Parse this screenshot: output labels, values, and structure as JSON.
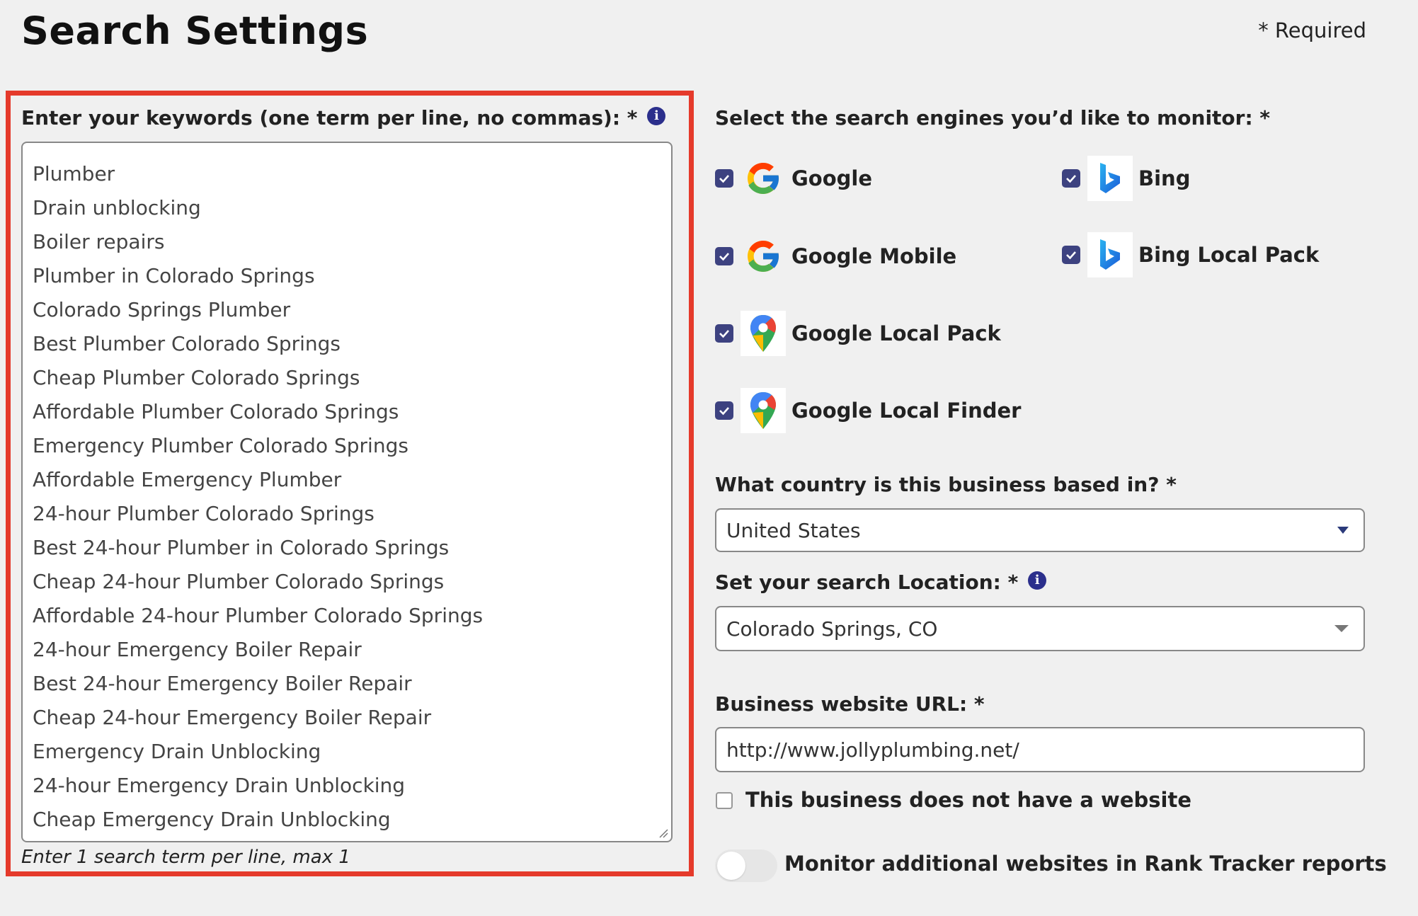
{
  "header": {
    "title": "Search Settings",
    "required_note": "*  Required"
  },
  "keywords": {
    "label": "Enter your keywords (one term per line, no commas): *",
    "info_icon": "info-icon",
    "lines": [
      "Plumber",
      "Drain unblocking",
      "Boiler repairs",
      "Plumber in Colorado Springs",
      "Colorado Springs Plumber",
      "Best Plumber Colorado Springs",
      "Cheap Plumber Colorado Springs",
      "Affordable Plumber Colorado Springs",
      "Emergency Plumber Colorado Springs",
      "Affordable Emergency Plumber",
      "24-hour Plumber Colorado Springs",
      "Best 24-hour Plumber in Colorado Springs",
      "Cheap 24-hour Plumber Colorado Springs",
      "Affordable 24-hour Plumber Colorado Springs",
      "24-hour Emergency Boiler Repair",
      "Best 24-hour Emergency Boiler Repair",
      "Cheap 24-hour Emergency Boiler Repair",
      "Emergency Drain Unblocking",
      "24-hour Emergency Drain Unblocking",
      "Cheap Emergency Drain Unblocking"
    ],
    "helper": "Enter 1 search term per line, max 1",
    "highlight_color": "#e53a2b"
  },
  "engines": {
    "label": "Select the search engines you’d like to monitor: *",
    "items": [
      {
        "name": "Google",
        "checked": true,
        "icon": "google-icon"
      },
      {
        "name": "Bing",
        "checked": true,
        "icon": "bing-icon"
      },
      {
        "name": "Google Mobile",
        "checked": true,
        "icon": "google-icon"
      },
      {
        "name": "Bing Local Pack",
        "checked": true,
        "icon": "bing-icon"
      },
      {
        "name": "Google Local Pack",
        "checked": true,
        "icon": "google-maps-pin-icon"
      },
      {
        "name": "Google Local Finder",
        "checked": true,
        "icon": "google-maps-pin-icon"
      }
    ]
  },
  "country": {
    "label": "What country is this business based in? *",
    "value": "United States"
  },
  "location": {
    "label": "Set your search Location: *",
    "value": "Colorado Springs, CO"
  },
  "website": {
    "label": "Business website URL: *",
    "value": "http://www.jollyplumbing.net/"
  },
  "no_website": {
    "label": "This business does not have a website",
    "checked": false
  },
  "monitor": {
    "label": "Monitor additional websites in Rank Tracker reports",
    "enabled": false
  },
  "colors": {
    "checkbox": "#3d4280",
    "info": "#2b2f8c",
    "accent_red": "#e53a2b"
  }
}
